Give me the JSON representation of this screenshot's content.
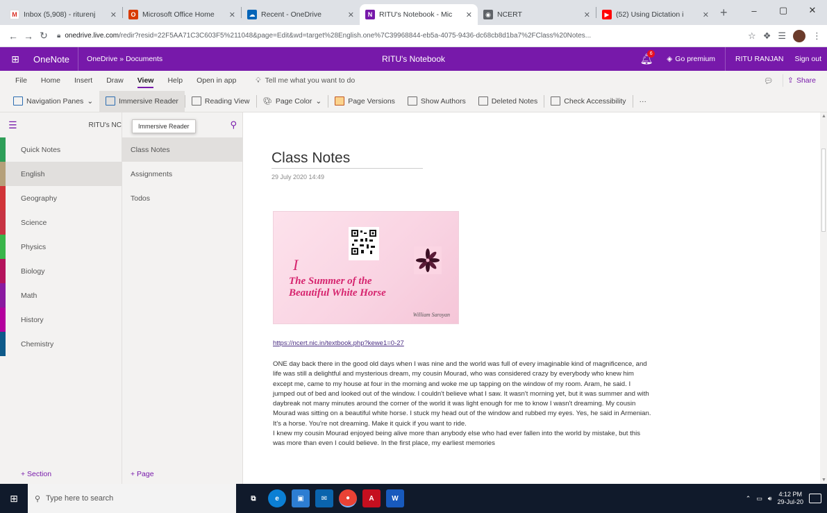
{
  "browser": {
    "tabs": [
      {
        "title": "Inbox (5,908) - riturenj",
        "color": "#d93025",
        "glyph": "M"
      },
      {
        "title": "Microsoft Office Home",
        "color": "#d83b01",
        "glyph": "O"
      },
      {
        "title": "Recent - OneDrive",
        "color": "#0364b8",
        "glyph": "☁"
      },
      {
        "title": "RITU's Notebook - Mic",
        "color": "#7719aa",
        "glyph": "N"
      },
      {
        "title": "NCERT",
        "color": "#5f6368",
        "glyph": "◉"
      },
      {
        "title": "(52) Using Dictation i",
        "color": "#ff0000",
        "glyph": "▶"
      }
    ],
    "url_domain": "onedrive.live.com",
    "url_rest": "/redir?resid=22F5AA71C3C603F5%211048&page=Edit&wd=target%28English.one%7C39968844-eb5a-4075-9436-dc68cb8d1ba7%2FClass%20Notes..."
  },
  "app": {
    "name": "OneNote",
    "breadcrumb": "OneDrive » Documents",
    "notebook_title": "RITU's Notebook",
    "notification_count": "6",
    "premium": "Go premium",
    "user": "RITU RANJAN",
    "signout": "Sign out"
  },
  "ribbon": {
    "tabs": [
      "File",
      "Home",
      "Insert",
      "Draw",
      "View",
      "Help"
    ],
    "active_tab": "View",
    "open_in_app": "Open in app",
    "tell_me": "Tell me what you want to do",
    "share": "Share",
    "commands": [
      "Navigation Panes",
      "Immersive Reader",
      "Reading View",
      "Page Color",
      "Page Versions",
      "Show Authors",
      "Deleted Notes",
      "Check Accessibility"
    ],
    "more": "···"
  },
  "tooltip": "Immersive Reader",
  "sections_pane": {
    "notebook_short": "RITU's NC",
    "items": [
      {
        "label": "Quick Notes",
        "color": "#2e9e58"
      },
      {
        "label": "English",
        "color": "#b5a07a"
      },
      {
        "label": "Geography",
        "color": "#d13438"
      },
      {
        "label": "Science",
        "color": "#c73343"
      },
      {
        "label": "Physics",
        "color": "#39b54a"
      },
      {
        "label": "Biology",
        "color": "#b4135c"
      },
      {
        "label": "Math",
        "color": "#8a1aa0"
      },
      {
        "label": "History",
        "color": "#b4009e"
      },
      {
        "label": "Chemistry",
        "color": "#0e5a8a"
      }
    ],
    "selected_index": 1,
    "add_section": "+ Section"
  },
  "pages_pane": {
    "items": [
      "Class Notes",
      "Assignments",
      "Todos"
    ],
    "selected_index": 0,
    "add_page": "+ Page"
  },
  "page": {
    "title": "Class Notes",
    "date": "29 July 2020   14:49",
    "cover_number": "I",
    "cover_title_line1": "The Summer of the",
    "cover_title_line2": "Beautiful White Horse",
    "cover_author": "William Saroyan",
    "qr_caption": "",
    "link": "https://ncert.nic.in/textbook.php?kewe1=0-27",
    "paragraph1": "ONE day back there in the good old days when I was nine and the world was full of every imaginable kind of magnificence, and life was still a delightful and mysterious dream, my cousin Mourad, who was considered crazy by everybody who knew him except me, came to my house at four in the morning and woke me up tapping on the window of my room. Aram, he said. I jumped out of bed and looked out of the window. I couldn't believe what I saw. It wasn't morning yet, but it was summer and with daybreak not many minutes around the corner of the world it was light enough for me to know I wasn't dreaming. My cousin Mourad was sitting on a beautiful white horse. I stuck my head out of the window and rubbed my eyes. Yes, he said in Armenian. It's a horse. You're not dreaming. Make it quick if you want to ride.",
    "paragraph2": "I knew my cousin Mourad enjoyed being alive more than anybody else who had ever fallen into the world by mistake, but this was more than even I could believe. In the first place, my earliest memories"
  },
  "taskbar": {
    "search_placeholder": "Type here to search",
    "time": "4:12 PM",
    "date": "29-Jul-20"
  }
}
